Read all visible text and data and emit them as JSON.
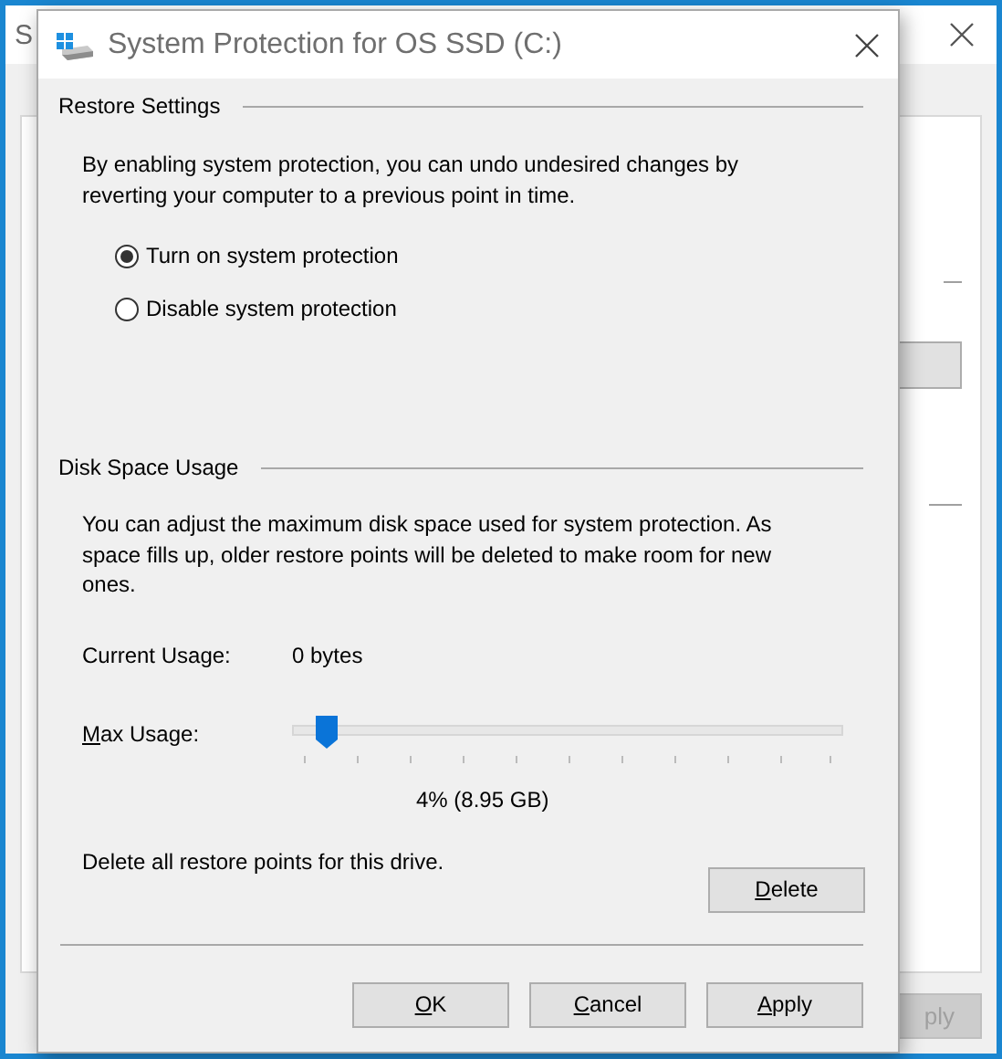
{
  "background_window": {
    "title": "S",
    "apply_button": {
      "label": "ply",
      "disabled": true
    }
  },
  "dialog": {
    "title": "System Protection for OS SSD (C:)",
    "restore_settings": {
      "heading": "Restore Settings",
      "description": "By enabling system protection, you can undo undesired changes by reverting your computer to a previous point in time.",
      "options": [
        {
          "label": "Turn on system protection",
          "selected": true
        },
        {
          "label": "Disable system protection",
          "selected": false
        }
      ]
    },
    "disk_space_usage": {
      "heading": "Disk Space Usage",
      "description": "You can adjust the maximum disk space used for system protection. As space fills up, older restore points will be deleted to make room for new ones.",
      "current_usage_label": "Current Usage:",
      "current_usage_value": "0 bytes",
      "max_usage_label": "Max Usage:",
      "max_usage": {
        "level": 0.04
      },
      "max_usage_reading": "4% (8.95 GB)",
      "delete_text": "Delete all restore points for this drive.",
      "delete_button": "Delete"
    },
    "buttons": [
      {
        "label": "OK"
      },
      {
        "label": "Cancel"
      },
      {
        "label": "Apply"
      }
    ]
  }
}
